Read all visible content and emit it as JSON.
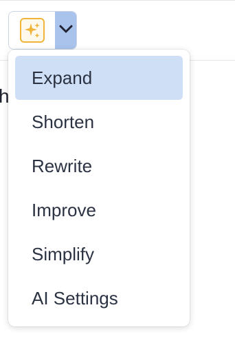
{
  "toolbar": {
    "ai_button_icon": "sparkles-icon",
    "dropdown_icon": "chevron-down-icon",
    "accent_color": "#f0b43a",
    "dropdown_bg": "#a9c3ec"
  },
  "background_text": "h",
  "menu": {
    "items": [
      {
        "label": "Expand",
        "active": true
      },
      {
        "label": "Shorten",
        "active": false
      },
      {
        "label": "Rewrite",
        "active": false
      },
      {
        "label": "Improve",
        "active": false
      },
      {
        "label": "Simplify",
        "active": false
      },
      {
        "label": "AI Settings",
        "active": false
      }
    ],
    "active_bg": "#cfdff6"
  }
}
